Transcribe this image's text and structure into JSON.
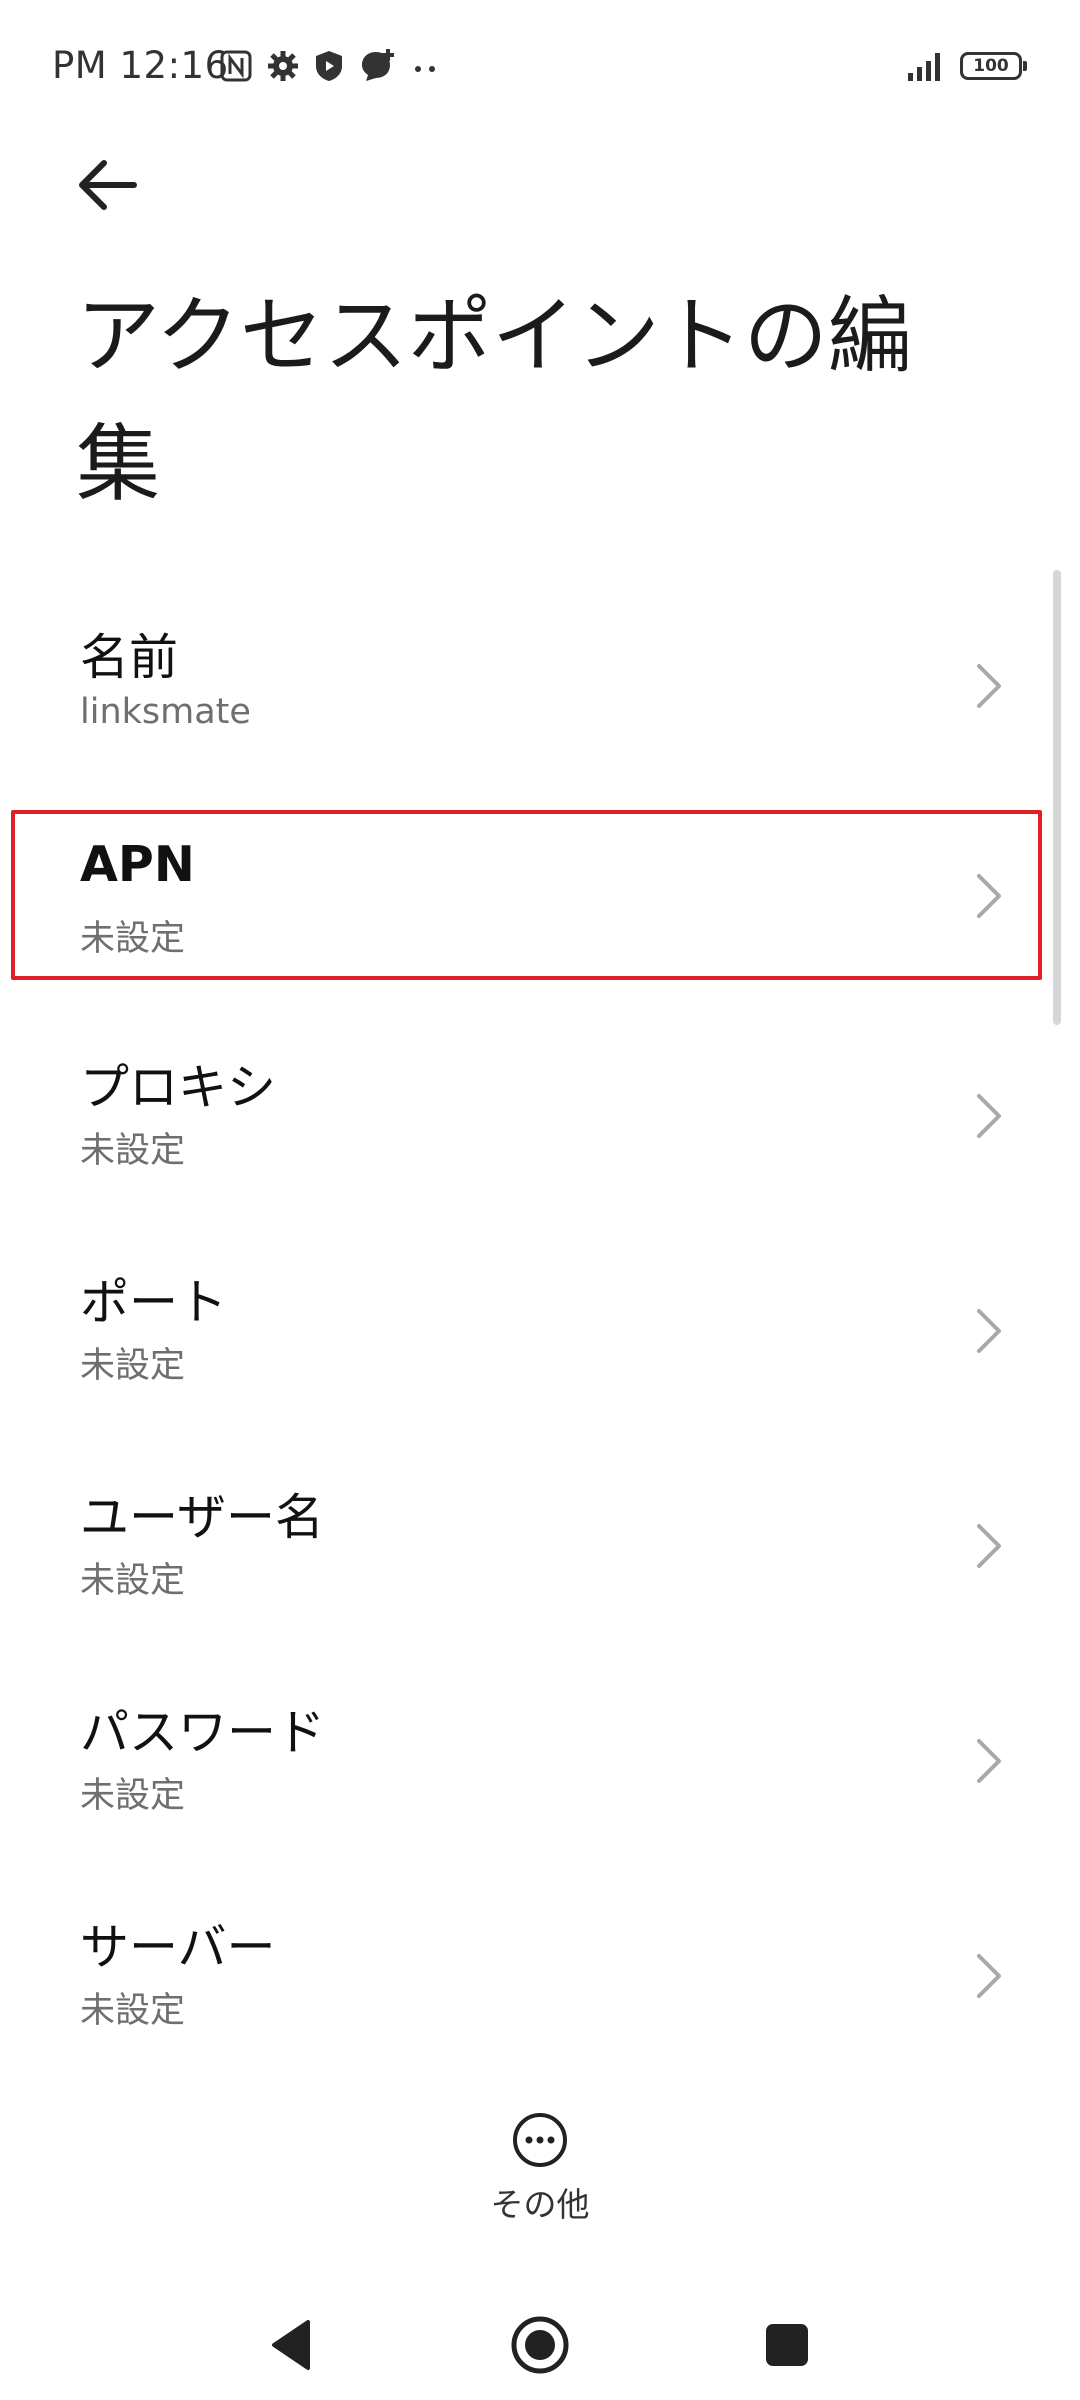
{
  "status_bar": {
    "time": "PM 12:16",
    "battery": "100",
    "left_icons": [
      "nfc-icon",
      "settings-gear-icon",
      "shield-icon",
      "chat-bubble-icon",
      "more-dots-icon"
    ],
    "right_icons": [
      "signal-icon",
      "battery-icon"
    ]
  },
  "header": {
    "back_icon": "arrow-left-icon",
    "title": "アクセスポイントの編集"
  },
  "settings": [
    {
      "title": "名前",
      "value": "linksmate"
    },
    {
      "title": "APN",
      "value": "未設定",
      "highlighted": true,
      "highlight_color": "#e01f26"
    },
    {
      "title": "プロキシ",
      "value": "未設定"
    },
    {
      "title": "ポート",
      "value": "未設定"
    },
    {
      "title": "ユーザー名",
      "value": "未設定"
    },
    {
      "title": "パスワード",
      "value": "未設定"
    },
    {
      "title": "サーバー",
      "value": "未設定"
    }
  ],
  "more": {
    "label": "その他",
    "icon": "more-circle-icon"
  },
  "nav_bar": {
    "icons": [
      "back-triangle-icon",
      "home-circle-icon",
      "recents-square-icon"
    ]
  }
}
